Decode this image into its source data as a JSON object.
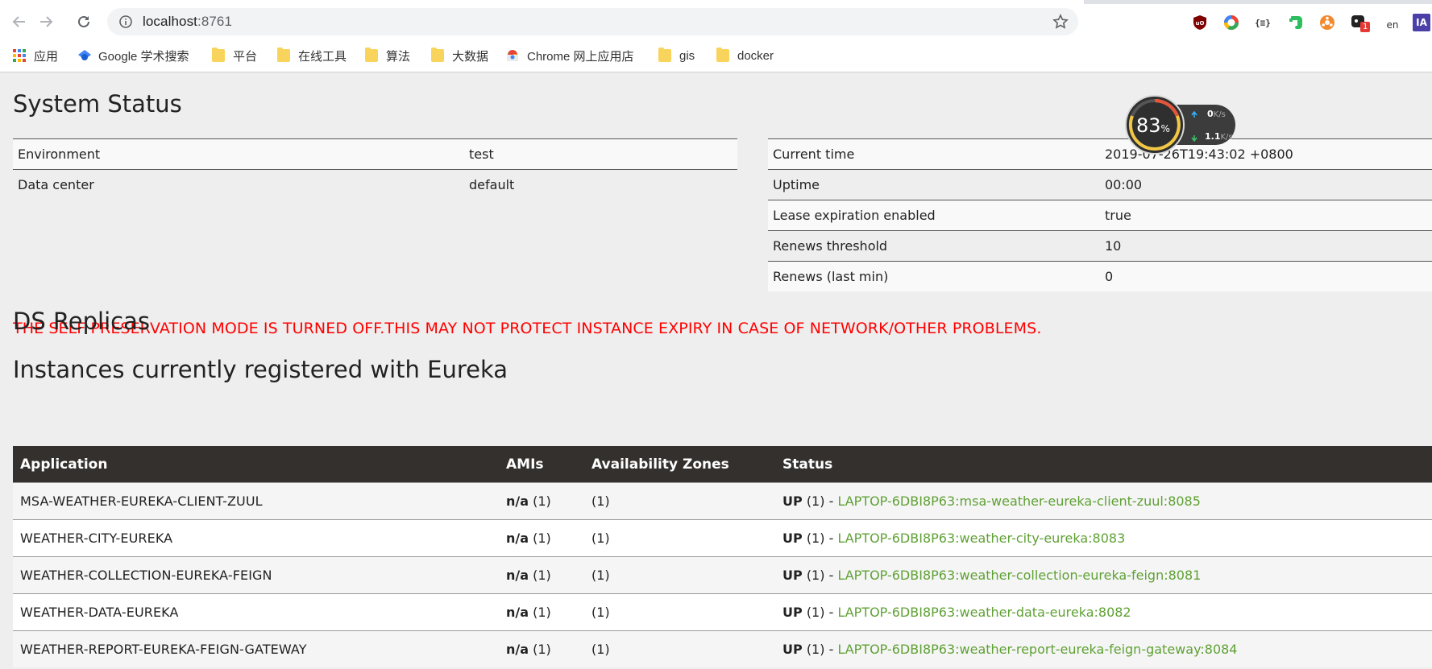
{
  "browser": {
    "url_host": "localhost",
    "url_port": ":8761",
    "extensions": [
      "ublock-icon",
      "chrome-color-icon",
      "json-viewer-icon",
      "evernote-icon",
      "orange-extension-icon",
      "badge-extension-icon",
      "translate-icon",
      "ia-icon"
    ],
    "extension_badge": "1",
    "translate_label": "en",
    "ia_label": "IA",
    "bookmarks": [
      {
        "label": "应用",
        "icon": "apps-grid-icon"
      },
      {
        "label": "Google 学术搜索",
        "icon": "scholar-icon"
      },
      {
        "label": "平台",
        "icon": "folder-icon"
      },
      {
        "label": "在线工具",
        "icon": "folder-icon"
      },
      {
        "label": "算法",
        "icon": "folder-icon"
      },
      {
        "label": "大数据",
        "icon": "folder-icon"
      },
      {
        "label": "Chrome 网上应用店",
        "icon": "webstore-icon"
      },
      {
        "label": "gis",
        "icon": "folder-icon"
      },
      {
        "label": "docker",
        "icon": "folder-icon"
      }
    ]
  },
  "netmon": {
    "percent": "83",
    "percent_unit": "%",
    "upload": "0",
    "download": "1.1",
    "unit": "K/s"
  },
  "system_status": {
    "title": "System Status",
    "left": [
      {
        "key": "Environment",
        "value": "test"
      },
      {
        "key": "Data center",
        "value": "default"
      }
    ],
    "right": [
      {
        "key": "Current time",
        "value": "2019-07-26T19:43:02 +0800"
      },
      {
        "key": "Uptime",
        "value": "00:00"
      },
      {
        "key": "Lease expiration enabled",
        "value": "true"
      },
      {
        "key": "Renews threshold",
        "value": "10"
      },
      {
        "key": "Renews (last min)",
        "value": "0"
      }
    ]
  },
  "warning": "THE SELF PRESERVATION MODE IS TURNED OFF.THIS MAY NOT PROTECT INSTANCE EXPIRY IN CASE OF NETWORK/OTHER PROBLEMS.",
  "ds_replicas_title": "DS Replicas",
  "instances": {
    "title": "Instances currently registered with Eureka",
    "headers": [
      "Application",
      "AMIs",
      "Availability Zones",
      "Status"
    ],
    "rows": [
      {
        "app": "MSA-WEATHER-EUREKA-CLIENT-ZUUL",
        "ami": "n/a",
        "ami_count": "(1)",
        "zones": "(1)",
        "status": "UP",
        "status_count": "(1) -",
        "link": "LAPTOP-6DBI8P63:msa-weather-eureka-client-zuul:8085"
      },
      {
        "app": "WEATHER-CITY-EUREKA",
        "ami": "n/a",
        "ami_count": "(1)",
        "zones": "(1)",
        "status": "UP",
        "status_count": "(1) -",
        "link": "LAPTOP-6DBI8P63:weather-city-eureka:8083"
      },
      {
        "app": "WEATHER-COLLECTION-EUREKA-FEIGN",
        "ami": "n/a",
        "ami_count": "(1)",
        "zones": "(1)",
        "status": "UP",
        "status_count": "(1) -",
        "link": "LAPTOP-6DBI8P63:weather-collection-eureka-feign:8081"
      },
      {
        "app": "WEATHER-DATA-EUREKA",
        "ami": "n/a",
        "ami_count": "(1)",
        "zones": "(1)",
        "status": "UP",
        "status_count": "(1) -",
        "link": "LAPTOP-6DBI8P63:weather-data-eureka:8082"
      },
      {
        "app": "WEATHER-REPORT-EUREKA-FEIGN-GATEWAY",
        "ami": "n/a",
        "ami_count": "(1)",
        "zones": "(1)",
        "status": "UP",
        "status_count": "(1) -",
        "link": "LAPTOP-6DBI8P63:weather-report-eureka-feign-gateway:8084"
      }
    ]
  },
  "colors": {
    "warning": "#ff0000",
    "link_green": "#5fa134",
    "table_header": "#34302d",
    "page_bg": "#eeeeee"
  }
}
